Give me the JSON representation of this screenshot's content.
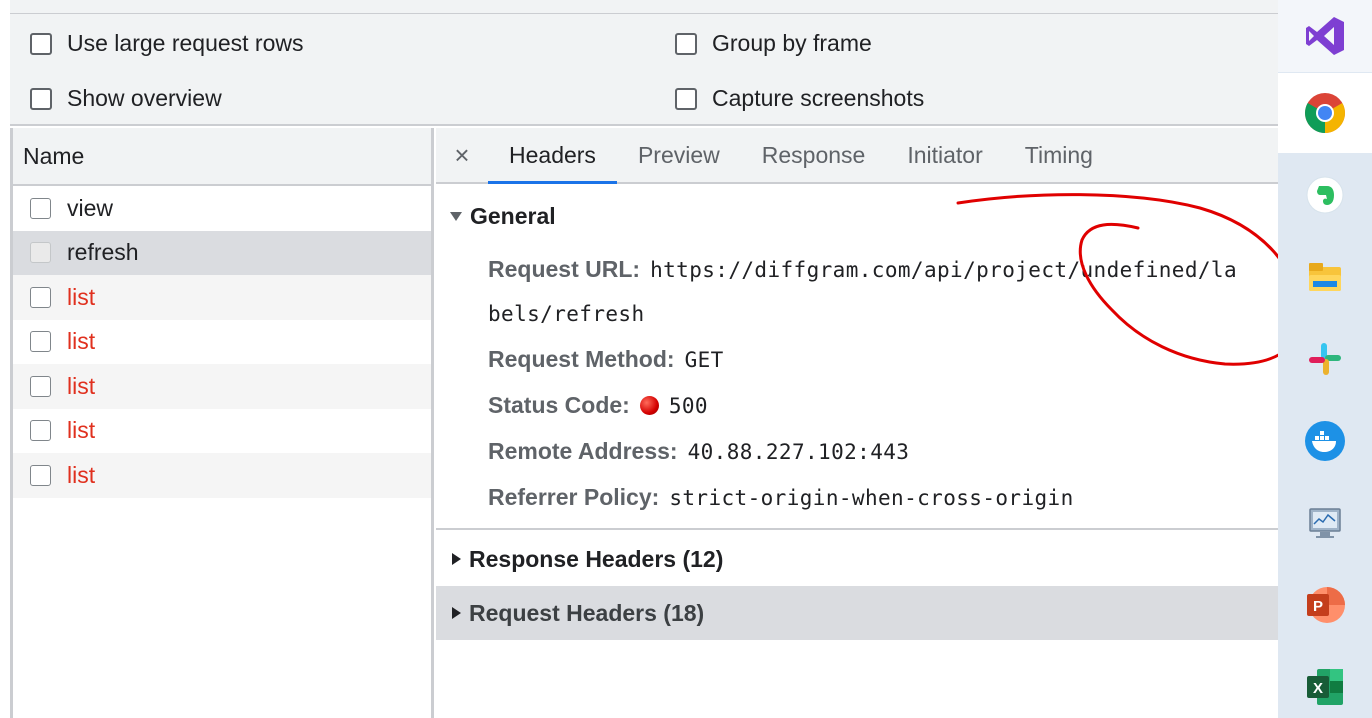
{
  "settings": {
    "large_rows": "Use large request rows",
    "group_by_frame": "Group by frame",
    "show_overview": "Show overview",
    "capture_screenshots": "Capture screenshots"
  },
  "left_panel": {
    "column_header": "Name",
    "requests": [
      {
        "name": "view",
        "status": "ok"
      },
      {
        "name": "refresh",
        "status": "selected"
      },
      {
        "name": "list",
        "status": "error"
      },
      {
        "name": "list",
        "status": "error"
      },
      {
        "name": "list",
        "status": "error"
      },
      {
        "name": "list",
        "status": "error"
      },
      {
        "name": "list",
        "status": "error"
      }
    ]
  },
  "details": {
    "close": "×",
    "tabs": [
      {
        "label": "Headers",
        "active": true
      },
      {
        "label": "Preview",
        "active": false
      },
      {
        "label": "Response",
        "active": false
      },
      {
        "label": "Initiator",
        "active": false
      },
      {
        "label": "Timing",
        "active": false
      }
    ],
    "general": {
      "title": "General",
      "request_url_label": "Request URL:",
      "request_url_line1": "https://diffgram.com/api/project/undefined/la",
      "request_url_line2": "bels/refresh",
      "method_label": "Request Method:",
      "method_value": "GET",
      "status_label": "Status Code:",
      "status_value": "500",
      "remote_label": "Remote Address:",
      "remote_value": "40.88.227.102:443",
      "referrer_label": "Referrer Policy:",
      "referrer_value": "strict-origin-when-cross-origin"
    },
    "response_headers": "Response Headers (12)",
    "request_headers": "Request Headers (18)"
  },
  "colors": {
    "error_text": "#e0301e",
    "active_tab_underline": "#1a73e8",
    "annotation_stroke": "#e00000"
  },
  "taskbar": {
    "apps": [
      "visual-studio-icon",
      "chrome-icon",
      "evernote-icon",
      "file-explorer-icon",
      "slack-icon",
      "docker-icon",
      "system-monitor-icon",
      "powerpoint-icon",
      "excel-icon"
    ]
  }
}
